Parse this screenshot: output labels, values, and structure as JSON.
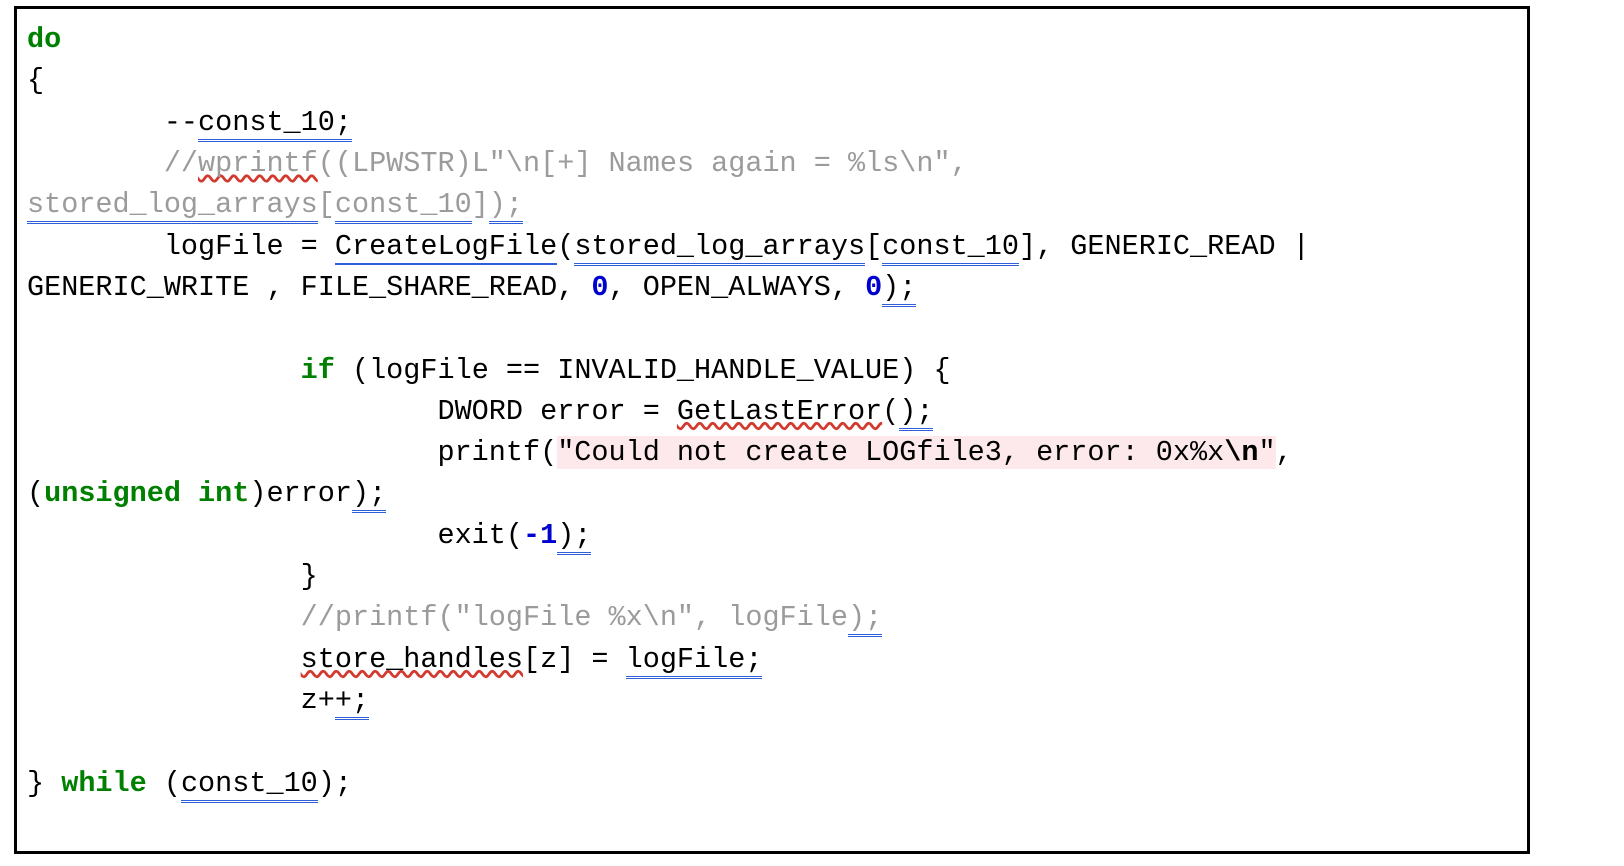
{
  "code": {
    "l1_kw_do": "do",
    "l2_brace": "{",
    "l3_indent": "        --",
    "l3_const10": "const_10",
    "l3_semi": ";",
    "l4_indent": "        ",
    "l4_slashes": "//",
    "l4_wprintf": "wprintf",
    "l4_rest": "((LPWSTR)L\"\\n[+] Names again = %ls\\n\", ",
    "l5_stored": "stored_log_arrays",
    "l5_idx_open": "[",
    "l5_const10": "const_10",
    "l5_idx_close": "]",
    "l5_paren_semi": ");",
    "l6_indent": "        logFile = ",
    "l6_fn": "CreateLogFile",
    "l6_open": "(",
    "l6_stored": "stored_log_arrays",
    "l6_idx_open": "[",
    "l6_const10": "const_10",
    "l6_rest1": "], GENERIC_READ | ",
    "l7_part1": "GENERIC_WRITE , FILE_SHARE_READ, ",
    "l7_zero1": "0",
    "l7_mid": ", OPEN_ALWAYS, ",
    "l7_zero2": "0",
    "l7_close": ");",
    "blank": "",
    "l9_indent": "                ",
    "l9_if": "if",
    "l9_rest": " (logFile == INVALID_HANDLE_VALUE) {",
    "l10_indent": "                        DWORD error = ",
    "l10_get": "GetLastError",
    "l10_rest": "(",
    "l10_close": ");",
    "l11_indent": "                        printf(",
    "l11_str_body": "\"Could not create LOGfile3, error: 0x%x",
    "l11_esc": "\\n",
    "l11_str_end": "\"",
    "l11_comma": ", ",
    "l12_open": "(",
    "l12_unsigned": "unsigned int",
    "l12_rest": ")error",
    "l12_close": ");",
    "l13_indent": "                        exit(",
    "l13_minus": "-",
    "l13_one": "1",
    "l13_close": ");",
    "l14_indent": "                }",
    "l15_indent": "                ",
    "l15_slashes": "//",
    "l15_rest": "printf(\"logFile %x\\n\", logFile",
    "l15_close": ");",
    "l16_indent": "                ",
    "l16_store": "store_handles",
    "l16_idx": "[z] = ",
    "l16_logfile": "logFile;",
    "l17_indent": "                z+",
    "l17_plus_semi": "+;",
    "l19_brace": "} ",
    "l19_while": "while",
    "l19_open": " (",
    "l19_const10": "const_10",
    "l19_close": ");"
  }
}
